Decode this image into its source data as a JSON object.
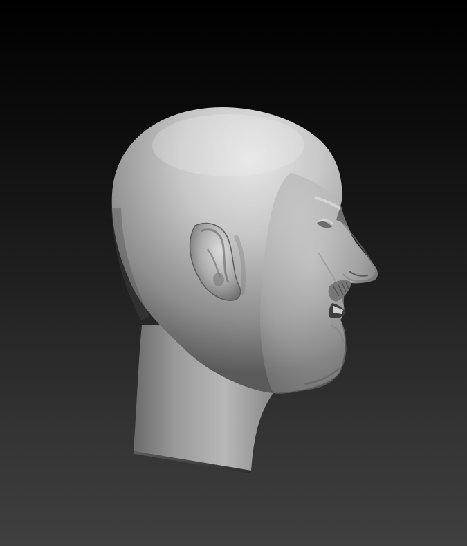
{
  "scene": {
    "subject": "sculpted-head-profile",
    "view": "side",
    "background_top": "#000000",
    "background_bottom": "#3f3f3f",
    "material_light": "#e2e2e2",
    "material_mid": "#9c9c9c",
    "material_dark": "#4a4a4a"
  }
}
